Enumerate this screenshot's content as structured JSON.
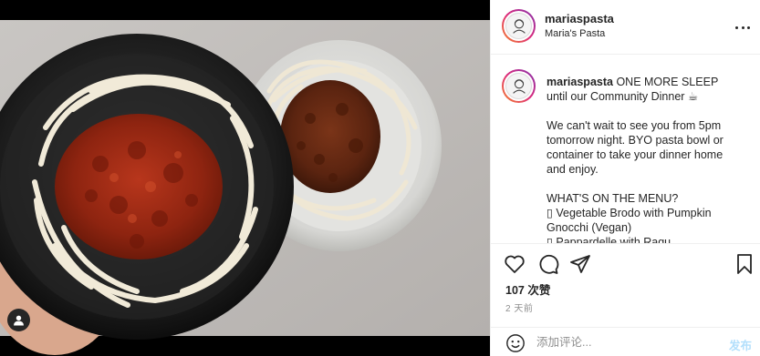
{
  "post": {
    "media": {
      "description_icon": "tag-user-icon"
    },
    "header": {
      "username": "mariaspasta",
      "location": "Maria's Pasta",
      "more_icon": "more-options-icon"
    },
    "caption": {
      "username": "mariaspasta",
      "line1": " ONE MORE SLEEP until our Community Dinner ☕",
      "paragraph2": "We can't wait to see you from 5pm tomorrow night. BYO pasta bowl or container to take your dinner home and enjoy.",
      "menu_heading": "WHAT'S ON THE MENU?",
      "menu_item1": "▯ Vegetable Brodo with Pumpkin Gnocchi (Vegan)",
      "menu_item2_partial": "▯ Pappardelle with Ragu"
    },
    "actions": {
      "like_icon": "heart-icon",
      "comment_icon": "comment-icon",
      "share_icon": "share-icon",
      "save_icon": "bookmark-icon"
    },
    "likes": "107 次赞",
    "timestamp": "2 天前",
    "comment": {
      "placeholder": "添加评论...",
      "emoji_icon": "emoji-icon",
      "post_label": "发布"
    }
  }
}
